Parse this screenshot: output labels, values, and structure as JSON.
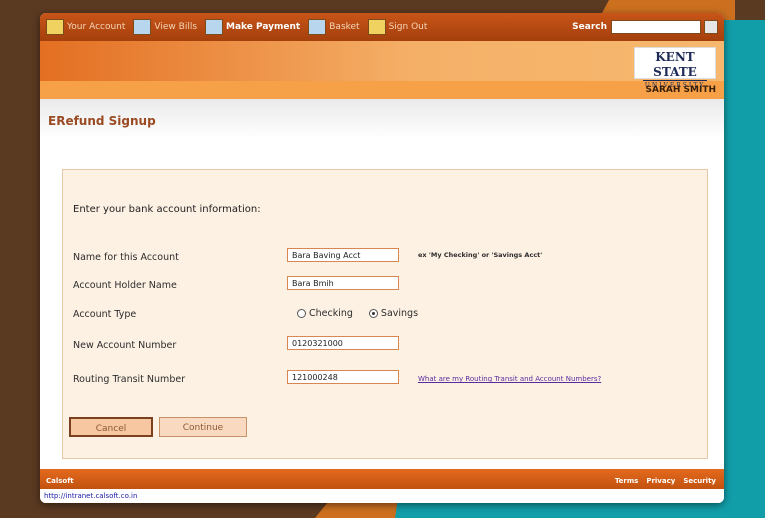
{
  "nav": {
    "items": [
      {
        "label": "Your Account",
        "icon": "account-icon"
      },
      {
        "label": "View Bills",
        "icon": "bills-icon"
      },
      {
        "label": "Make Payment",
        "icon": "payment-icon"
      },
      {
        "label": "Basket",
        "icon": "basket-icon"
      },
      {
        "label": "Sign Out",
        "icon": "signout-icon"
      }
    ],
    "search_label": "Search"
  },
  "logo": {
    "line1": "KENT STATE",
    "line2": "UNIVERSITY"
  },
  "user": {
    "name": "SARAH SMITH"
  },
  "page": {
    "title": "ERefund Signup"
  },
  "form": {
    "intro": "Enter your bank account information:",
    "account_name": {
      "label": "Name for this Account",
      "value": "Bara Baving Acct",
      "hint": "ex 'My Checking' or 'Savings Acct'"
    },
    "holder_name": {
      "label": "Account Holder Name",
      "value": "Bara Bmih"
    },
    "account_type": {
      "label": "Account Type",
      "options": [
        "Checking",
        "Savings"
      ],
      "selected": "Savings"
    },
    "account_number": {
      "label": "New Account Number",
      "value": "0120321000"
    },
    "routing_number": {
      "label": "Routing Transit Number",
      "value": "121000248"
    },
    "help_link": "What are my Routing Transit and Account Numbers?",
    "cancel": "Cancel",
    "continue": "Continue"
  },
  "footer": {
    "brand": "Calsoft",
    "links": [
      "Terms",
      "Privacy",
      "Security"
    ]
  },
  "status": {
    "url": "http://intranet.calsoft.co.in"
  },
  "colors": {
    "accent": "#e46a1e",
    "link": "#5b2b9e",
    "title": "#9a4b23"
  }
}
